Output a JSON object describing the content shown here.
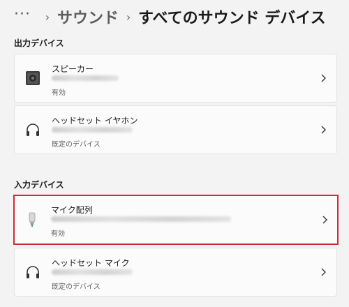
{
  "breadcrumb": {
    "more": "···",
    "parent": "サウンド",
    "current": "すべてのサウンド デバイス",
    "separator": "›"
  },
  "output": {
    "label": "出力デバイス",
    "devices": [
      {
        "name": "スピーカー",
        "status": "有効"
      },
      {
        "name": "ヘッドセット イヤホン",
        "status": "既定のデバイス"
      }
    ]
  },
  "input": {
    "label": "入力デバイス",
    "devices": [
      {
        "name": "マイク配列",
        "status": "有効"
      },
      {
        "name": "ヘッドセット マイク",
        "status": "既定のデバイス"
      }
    ]
  },
  "colors": {
    "background": "#f3f3f3",
    "card": "#fbfbfb",
    "highlight": "#d22a35"
  }
}
